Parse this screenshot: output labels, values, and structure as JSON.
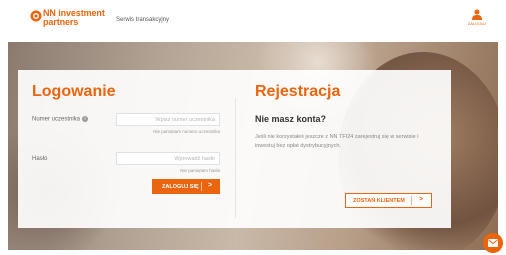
{
  "header": {
    "brand_line1": "NN investment",
    "brand_line2": "partners",
    "nav_link": "Serwis transakcyjny",
    "user_label": "ZALOGUJ",
    "accent_color": "#ea650d"
  },
  "login": {
    "title": "Logowanie",
    "participant_label": "Numer uczestnika",
    "participant_placeholder": "Wpisz numer uczestnika",
    "forgot_number": "Nie pamiętam numeru uczestnika",
    "password_label": "Hasło",
    "password_placeholder": "Wprowadź hasło",
    "forgot_password": "Nie pamiętam hasła",
    "submit_label": "ZALOGUJ SIĘ",
    "submit_arrow": ">"
  },
  "register": {
    "title": "Rejestracja",
    "subtitle": "Nie masz konta?",
    "text": "Jeśli nie korzystałeś jeszcze z NN TFI24 zarejestruj się w serwisie i inwestuj bez opłat dystrybucyjnych.",
    "button_label": "ZOSTAŃ KLIENTEM",
    "button_arrow": ">"
  },
  "icons": {
    "logo": "nn-logo-icon",
    "user": "user-icon",
    "info": "info-icon",
    "mail": "mail-icon"
  }
}
